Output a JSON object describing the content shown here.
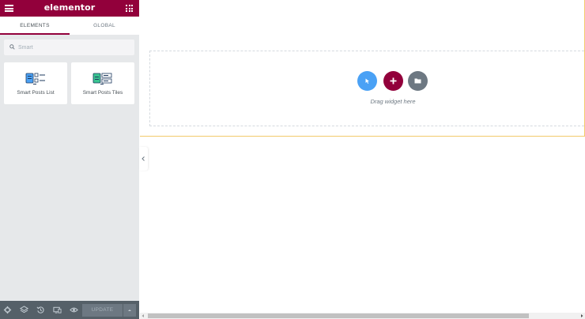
{
  "header": {
    "logo": "elementor",
    "brand_color": "#92003b"
  },
  "tabs": [
    {
      "label": "ELEMENTS",
      "active": true
    },
    {
      "label": "GLOBAL",
      "active": false
    }
  ],
  "search": {
    "placeholder": "Smart",
    "value": ""
  },
  "widgets": [
    {
      "label": "Smart Posts List",
      "icon": "smart-posts-list-icon"
    },
    {
      "label": "Smart Posts Tiles",
      "icon": "smart-posts-tiles-icon"
    }
  ],
  "footer": {
    "icons": [
      "settings-icon",
      "navigator-layers-icon",
      "history-icon",
      "responsive-mode-icon",
      "preview-eye-icon"
    ],
    "update_label": "UPDATE"
  },
  "canvas": {
    "drag_text": "Drag widget here",
    "buttons": [
      "navigator-button",
      "add-section-button",
      "add-template-button"
    ],
    "accent_blue": "#4aa1f5",
    "accent_gray": "#6d7882"
  }
}
